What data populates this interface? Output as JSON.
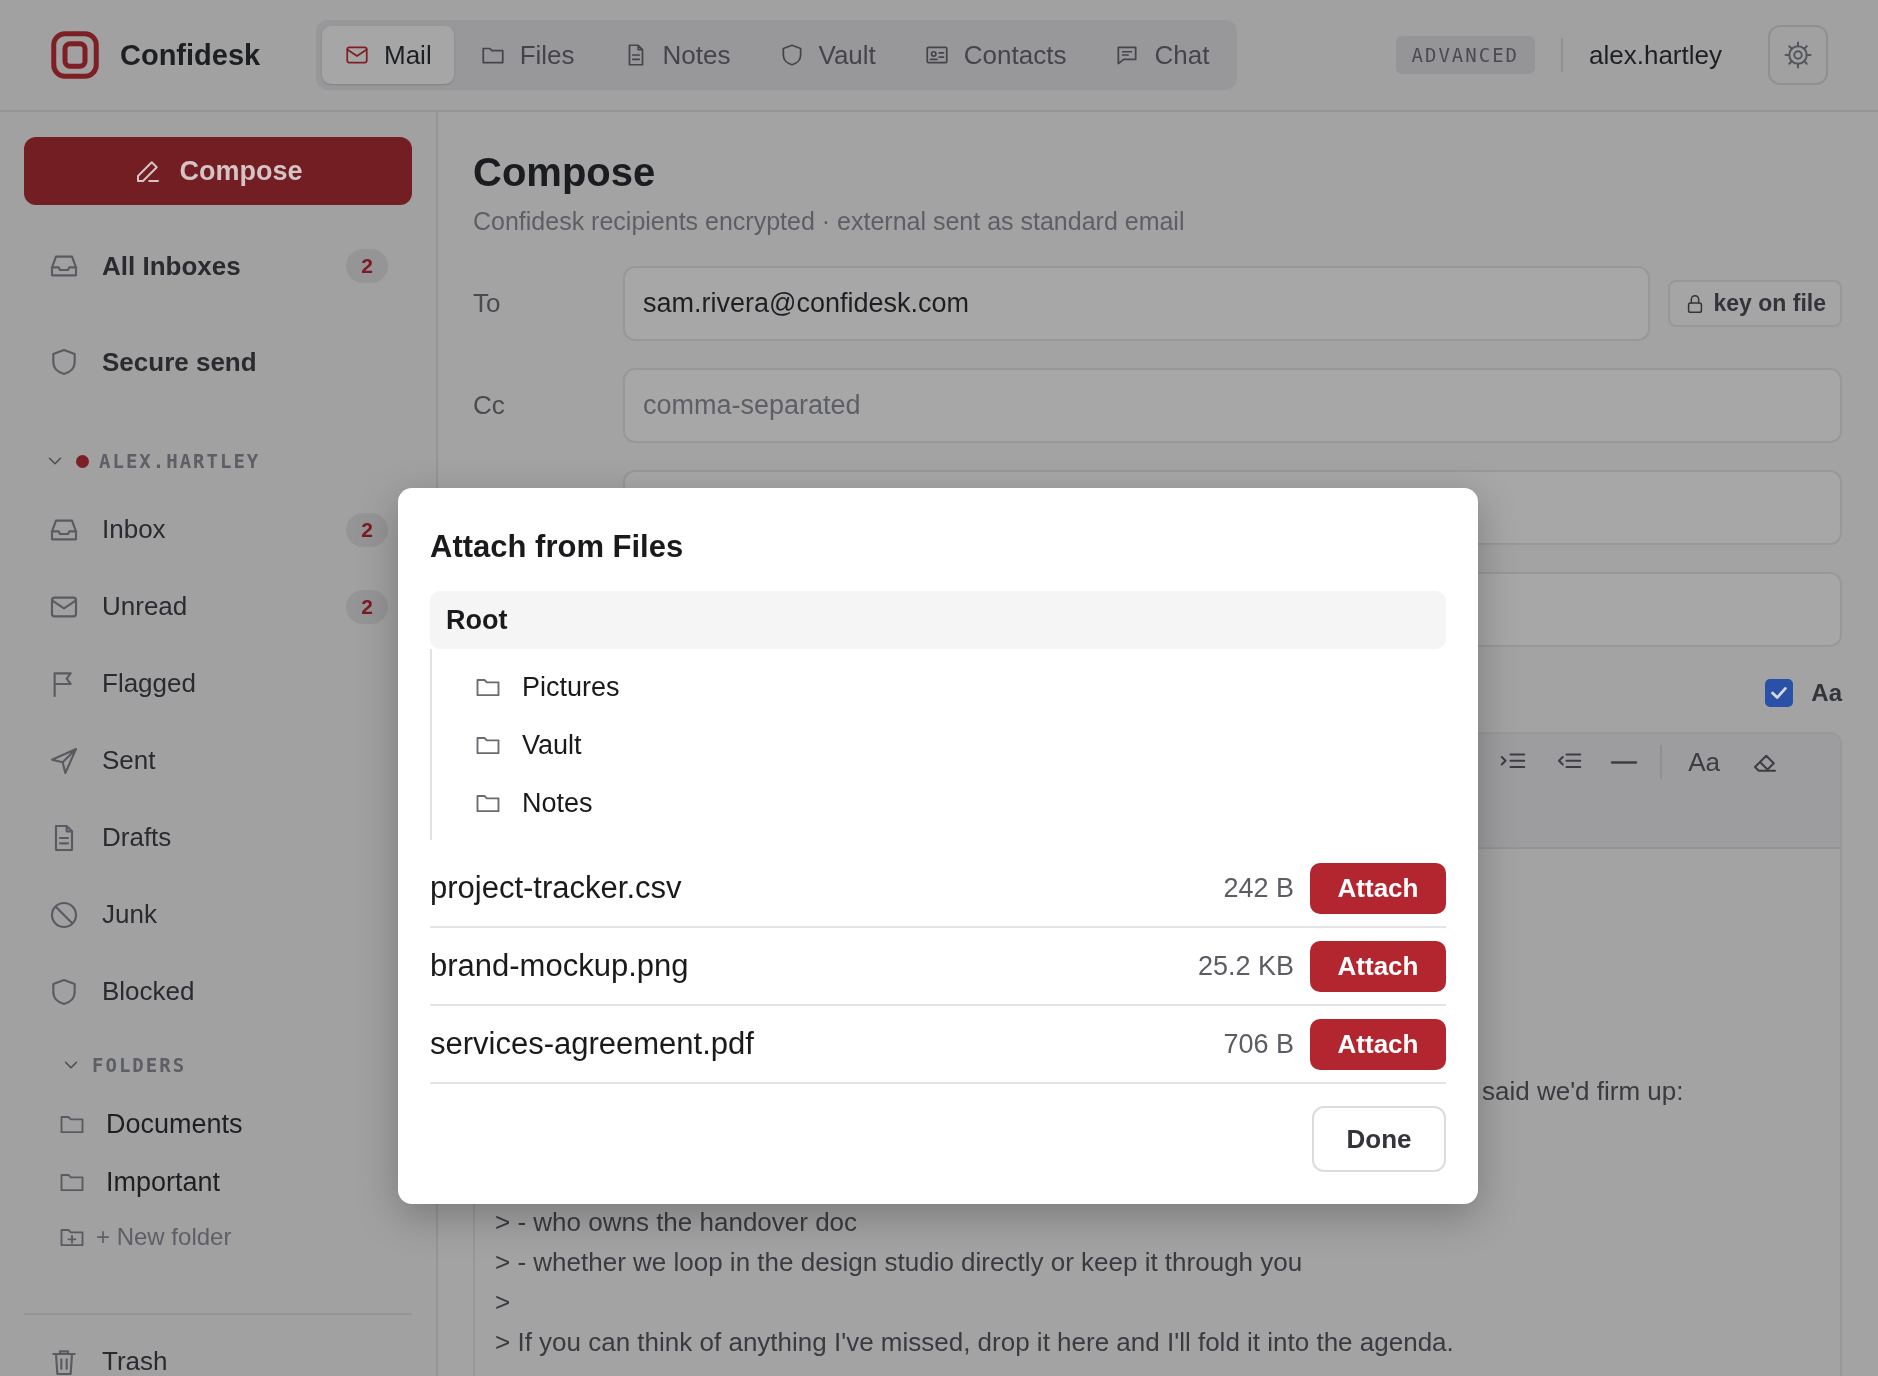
{
  "app": {
    "name": "Confidesk"
  },
  "nav_tabs": [
    {
      "label": "Mail",
      "selected": true
    },
    {
      "label": "Files",
      "selected": false
    },
    {
      "label": "Notes",
      "selected": false
    },
    {
      "label": "Vault",
      "selected": false
    },
    {
      "label": "Contacts",
      "selected": false
    },
    {
      "label": "Chat",
      "selected": false
    }
  ],
  "mode_badge": "ADVANCED",
  "user": "alex.hartley",
  "sidebar": {
    "compose_button": "Compose",
    "top_items": [
      {
        "label": "All Inboxes",
        "badge": "2"
      },
      {
        "label": "Secure send"
      }
    ],
    "account": {
      "label": "ALEX.HARTLEY",
      "expanded": true,
      "items": [
        {
          "label": "Inbox",
          "badge": "2"
        },
        {
          "label": "Unread",
          "badge": "2"
        },
        {
          "label": "Flagged"
        },
        {
          "label": "Sent"
        },
        {
          "label": "Drafts"
        },
        {
          "label": "Junk"
        },
        {
          "label": "Blocked"
        }
      ]
    },
    "folders": {
      "label": "FOLDERS",
      "expanded": true,
      "items": [
        "Documents",
        "Important"
      ],
      "new_folder": "+ New folder"
    },
    "bottom_items": [
      {
        "label": "Trash"
      }
    ]
  },
  "compose": {
    "title": "Compose",
    "subtitle": "Confidesk recipients encrypted · external sent as standard email",
    "fields": [
      {
        "kind": "text",
        "label": "To",
        "value": "sam.rivera@confidesk.com",
        "badge": "key on file"
      },
      {
        "kind": "text",
        "label": "Cc",
        "placeholder": "comma-separated"
      },
      {
        "kind": "blank"
      },
      {
        "kind": "blank"
      }
    ],
    "option": {
      "checked": true,
      "label": "Aa"
    },
    "toolbar": [
      {
        "kind": "indent"
      },
      {
        "kind": "outdent"
      },
      {
        "kind": "rule"
      },
      {
        "kind": "divider"
      },
      {
        "kind": "text",
        "label": "Aa"
      },
      {
        "kind": "eraser"
      }
    ],
    "body_lines": [
      {
        "kind": "partial",
        "text": "said we'd firm up:"
      },
      {
        "kind": "gap"
      },
      {
        "kind": "line",
        "text": "> - who owns the handover doc"
      },
      {
        "kind": "line",
        "text": "> - whether we loop in the design studio directly or keep it through you"
      },
      {
        "kind": "line",
        "text": ">"
      },
      {
        "kind": "line",
        "text": "> If you can think of anything I've missed, drop it here and I'll fold it into the agenda."
      }
    ]
  },
  "dialog": {
    "title": "Attach from Files",
    "root": "Root",
    "folders": [
      "Pictures",
      "Vault",
      "Notes"
    ],
    "files": [
      {
        "name": "project-tracker.csv",
        "size": "242 B",
        "action": "Attach"
      },
      {
        "name": "brand-mockup.png",
        "size": "25.2 KB",
        "action": "Attach"
      },
      {
        "name": "services-agreement.pdf",
        "size": "706 B",
        "action": "Attach"
      }
    ],
    "done_button": "Done"
  }
}
